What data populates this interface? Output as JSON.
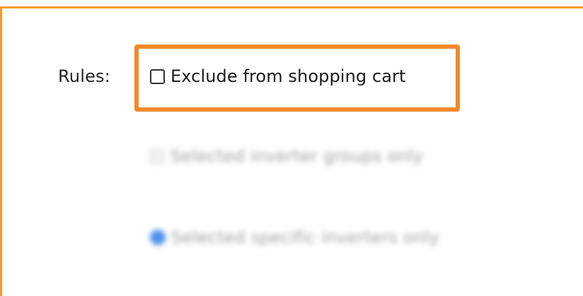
{
  "form": {
    "rules_label": "Rules:",
    "exclude_checkbox": {
      "label": "Exclude from shopping cart",
      "checked": false
    },
    "options": [
      {
        "label": "Selected inverter groups only",
        "selected": false
      },
      {
        "label": "Selected specific inverters only",
        "selected": true
      }
    ]
  },
  "colors": {
    "frame_border": "#F39C2E",
    "highlight_border": "#F0892B",
    "selected_radio": "#2F7BE8"
  }
}
